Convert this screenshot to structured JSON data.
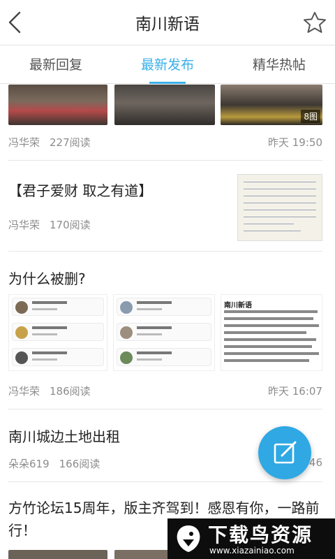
{
  "header": {
    "title": "南川新语",
    "back_icon": "chevron-left-icon",
    "favorite_icon": "star-outline-icon"
  },
  "tabs": [
    {
      "label": "最新回复",
      "active": false
    },
    {
      "label": "最新发布",
      "active": true
    },
    {
      "label": "精华热帖",
      "active": false
    }
  ],
  "posts": [
    {
      "author": "冯华荣",
      "reads": "227阅读",
      "time": "昨天 19:50",
      "image_count_badge": "8图"
    },
    {
      "title": "【君子爱财 取之有道】",
      "author": "冯华荣",
      "reads": "170阅读",
      "time": ""
    },
    {
      "title": "为什么被删?",
      "author": "冯华荣",
      "reads": "186阅读",
      "time": "昨天 16:07",
      "screenshot_text": {
        "heading": "南川新语",
        "names": [
          "冬瓜",
          "爱莫能助",
          "老木子の",
          "博晓时分"
        ]
      }
    },
    {
      "title": "南川城边土地出租",
      "author": "朵朵619",
      "reads": "166阅读",
      "time": "46"
    },
    {
      "title": "方竹论坛15周年，版主齐驾到！感恩有你，一路前行！"
    }
  ],
  "fab": {
    "icon": "compose-icon"
  },
  "watermark": {
    "text": "下载鸟资源",
    "url": "www.xiazainiao.com"
  },
  "colors": {
    "accent": "#3ab0e8",
    "fab": "#2fa8e4"
  }
}
